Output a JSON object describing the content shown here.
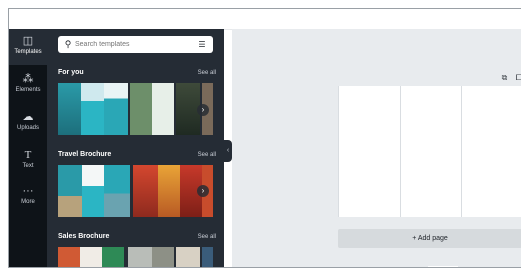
{
  "rail": {
    "items": [
      {
        "label": "Templates",
        "icon": "templates-icon"
      },
      {
        "label": "Elements",
        "icon": "elements-icon"
      },
      {
        "label": "Uploads",
        "icon": "uploads-icon"
      },
      {
        "label": "Text",
        "icon": "text-icon"
      },
      {
        "label": "More",
        "icon": "more-icon"
      }
    ]
  },
  "search": {
    "placeholder": "Search templates"
  },
  "sections": [
    {
      "title": "For you",
      "see_all": "See all"
    },
    {
      "title": "Travel Brochure",
      "see_all": "See all"
    },
    {
      "title": "Sales Brochure",
      "see_all": "See all"
    }
  ],
  "canvas": {
    "add_page_label": "+ Add page"
  },
  "colors": {
    "rail_bg": "#0e1318",
    "panel_bg": "#252c35",
    "canvas_bg": "#e8ebee"
  }
}
